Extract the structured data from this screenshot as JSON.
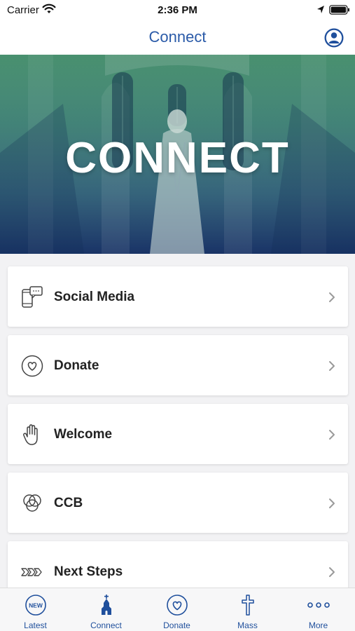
{
  "status": {
    "carrier": "Carrier",
    "time": "2:36 PM"
  },
  "header": {
    "title": "Connect"
  },
  "hero": {
    "title": "CONNECT"
  },
  "items": [
    {
      "label": "Social Media",
      "icon": "social-media-icon"
    },
    {
      "label": "Donate",
      "icon": "heart-icon"
    },
    {
      "label": "Welcome",
      "icon": "hand-icon"
    },
    {
      "label": "CCB",
      "icon": "circles-icon"
    },
    {
      "label": "Next Steps",
      "icon": "chevrons-icon"
    }
  ],
  "tabs": [
    {
      "label": "Latest",
      "icon": "new-icon",
      "badge": "NEW"
    },
    {
      "label": "Connect",
      "icon": "church-icon"
    },
    {
      "label": "Donate",
      "icon": "heart-icon"
    },
    {
      "label": "Mass",
      "icon": "cross-icon"
    },
    {
      "label": "More",
      "icon": "more-icon"
    }
  ],
  "colors": {
    "accent": "#1f4f9c",
    "title": "#2a5aa8"
  }
}
